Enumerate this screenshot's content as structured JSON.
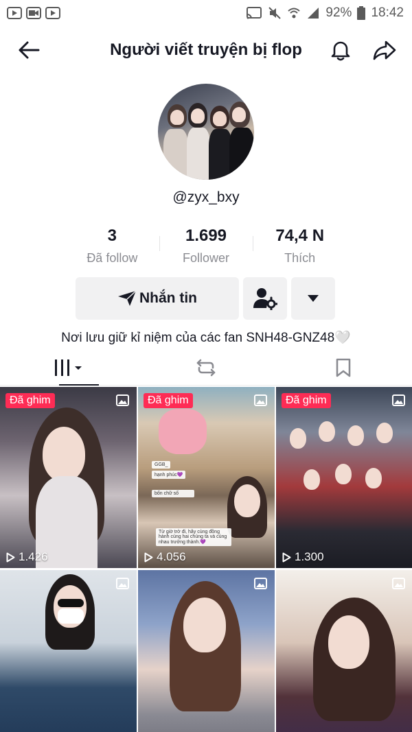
{
  "status_bar": {
    "battery": "92%",
    "time": "18:42"
  },
  "header": {
    "title": "Người viết truyện bị flop"
  },
  "profile": {
    "username": "@zyx_bxy",
    "bio": "Nơi lưu giữ kỉ niệm của các fan SNH48-GNZ48🤍"
  },
  "stats": [
    {
      "value": "3",
      "label": "Đã follow"
    },
    {
      "value": "1.699",
      "label": "Follower"
    },
    {
      "value": "74,4 N",
      "label": "Thích"
    }
  ],
  "actions": {
    "message_label": "Nhắn tin"
  },
  "videos": [
    {
      "pinned_label": "Đã ghim",
      "views": "1.426"
    },
    {
      "pinned_label": "Đã ghim",
      "views": "4.056",
      "chat_lines": [
        "hạnh phúc💜",
        "bốn chữ số",
        "Từ giờ trở đi, hãy cùng đồng hành cùng hai chúng ta và cùng nhau trưởng thành.💜"
      ],
      "chat_user": "GGB_"
    },
    {
      "pinned_label": "Đã ghim",
      "views": "1.300"
    },
    {
      "pinned_label": "",
      "views": ""
    },
    {
      "pinned_label": "",
      "views": ""
    },
    {
      "pinned_label": "",
      "views": ""
    }
  ],
  "colors": {
    "pin_badge": "#fe2c55",
    "text_primary": "#161823",
    "text_secondary": "#8a8b91",
    "button_bg": "#f1f1f2"
  }
}
